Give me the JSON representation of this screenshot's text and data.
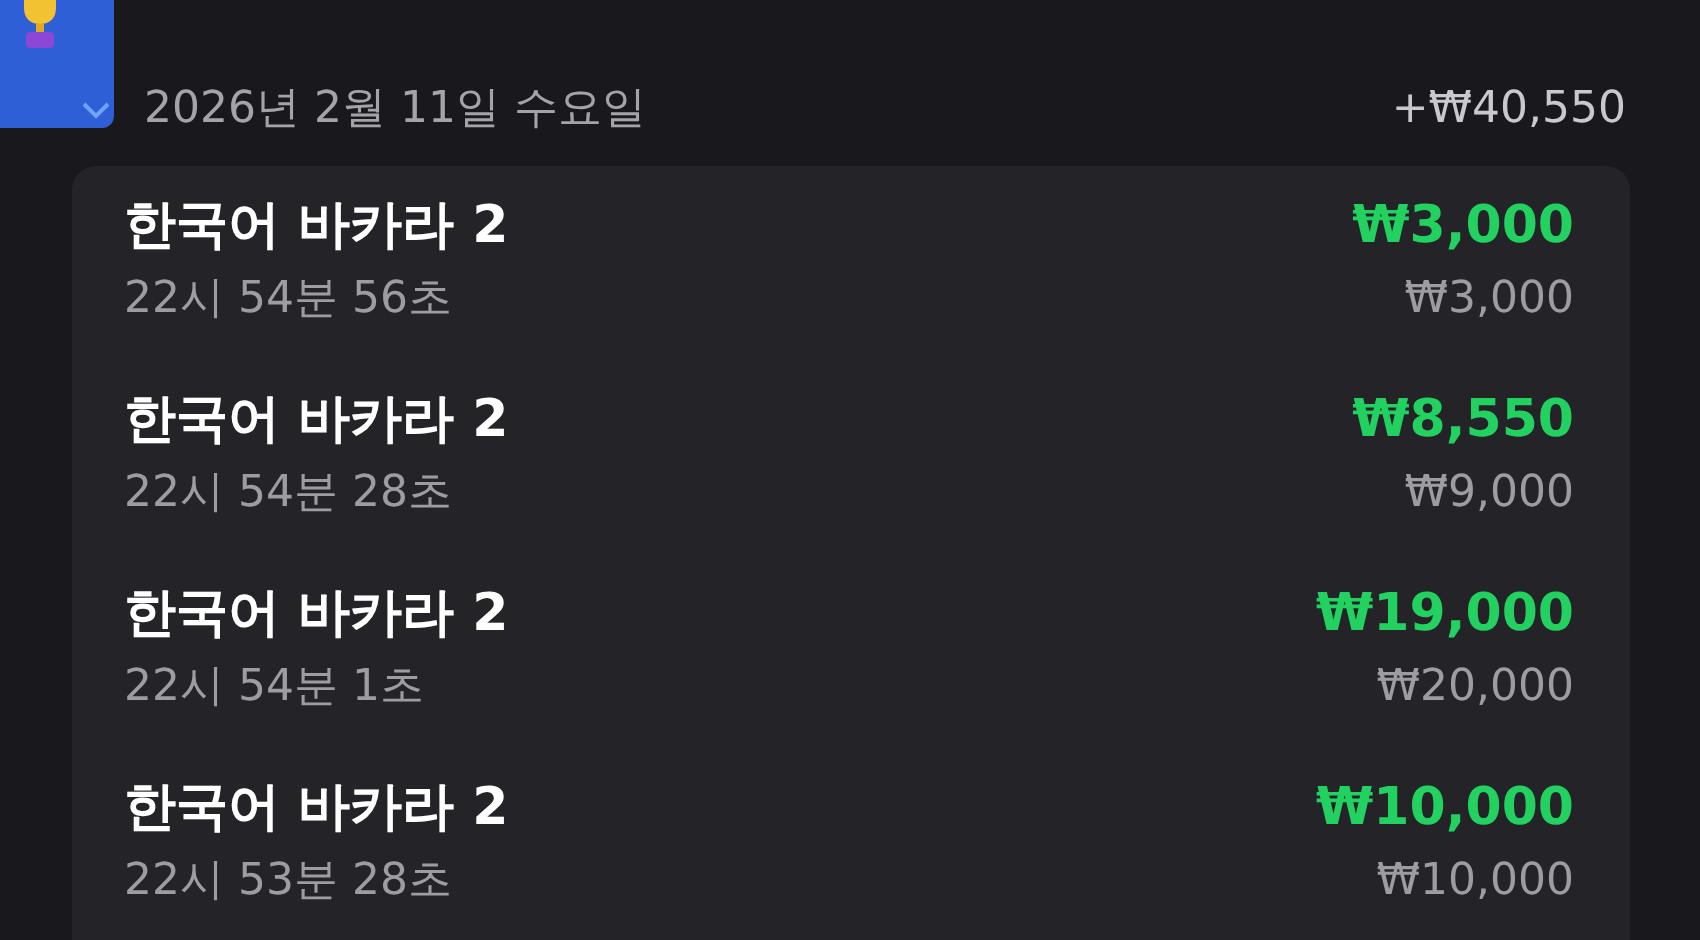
{
  "header": {
    "date": "2026년 2월 11일 수요일",
    "total": "+₩40,550"
  },
  "rows": [
    {
      "title": "한국어 바카라 2",
      "time": "22시 54분 56초",
      "payout": "₩3,000",
      "stake": "₩3,000"
    },
    {
      "title": "한국어 바카라 2",
      "time": "22시 54분 28초",
      "payout": "₩8,550",
      "stake": "₩9,000"
    },
    {
      "title": "한국어 바카라 2",
      "time": "22시 54분 1초",
      "payout": "₩19,000",
      "stake": "₩20,000"
    },
    {
      "title": "한국어 바카라 2",
      "time": "22시 53분 28초",
      "payout": "₩10,000",
      "stake": "₩10,000"
    }
  ]
}
